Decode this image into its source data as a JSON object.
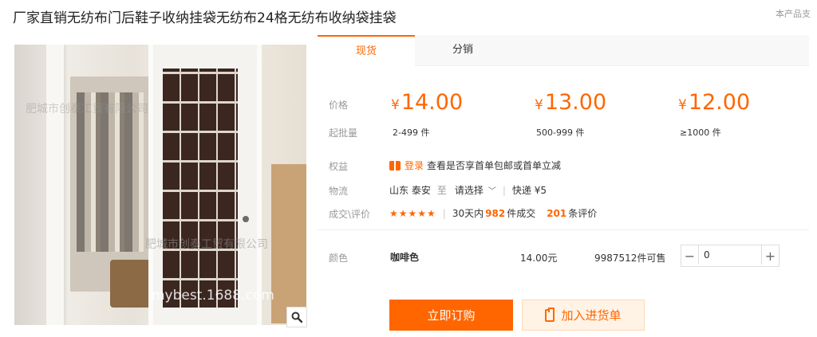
{
  "product": {
    "title": "厂家直销无纺布门后鞋子收纳挂袋无纺布24格无纺布收纳袋挂袋",
    "support_note": "本产品支"
  },
  "image": {
    "watermark_1": "肥城市创泰工贸有限公司",
    "watermark_2": "肥城市创泰工贸有限公司",
    "watermark_3": "mybest.1688.com",
    "zoom_icon": "magnifier-icon"
  },
  "tabs": [
    {
      "label": "现货",
      "active": true
    },
    {
      "label": "分销",
      "active": false
    }
  ],
  "pricing": {
    "price_label": "价格",
    "moq_label": "起批量",
    "currency": "¥",
    "tiers": [
      {
        "price": "14.00",
        "quantity": "2-499 件"
      },
      {
        "price": "13.00",
        "quantity": "500-999 件"
      },
      {
        "price": "12.00",
        "quantity": "≥1000 件"
      }
    ]
  },
  "benefits": {
    "label": "权益",
    "login_link": "登录",
    "text": "查看是否享首单包邮或首单立减"
  },
  "logistics": {
    "label": "物流",
    "origin": "山东 泰安",
    "to": "至",
    "destination_select": "请选择",
    "shipping": "快递 ¥5"
  },
  "reviews": {
    "label": "成交\\评价",
    "stars": "★★★★★",
    "rating": 5,
    "sold_prefix": "30天内",
    "sold_count": "982",
    "sold_suffix": "件成交",
    "review_count": "201",
    "review_suffix": "条评价"
  },
  "sku": {
    "label": "颜色",
    "name": "咖啡色",
    "price": "14.00元",
    "stock": "9987512件可售",
    "quantity": "0"
  },
  "actions": {
    "buy_now": "立即订购",
    "add_to_list": "加入进货单"
  },
  "colors": {
    "accent": "#ff6600",
    "label_gray": "#999999"
  }
}
